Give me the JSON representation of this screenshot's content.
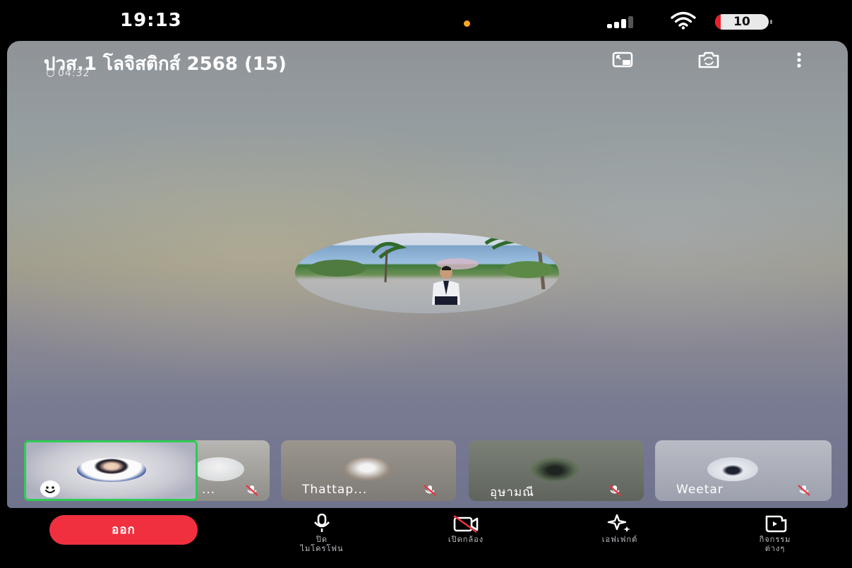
{
  "status_bar": {
    "time": "19:13",
    "battery_level": "10",
    "battery_fraction": 0.1,
    "signal_icon": "cellular-signal-icon",
    "wifi_icon": "wifi-icon",
    "dot_color": "#f5a623"
  },
  "call": {
    "room_title": "ปวส.1 โลจิสติกส์ 2568 (15)",
    "duration": "04:32",
    "top_icons": [
      "picture-in-picture-icon",
      "switch-camera-icon",
      "more-options-icon"
    ]
  },
  "participants": [
    {
      "name": "",
      "self": true,
      "emoji_icon": "smiley-icon"
    },
    {
      "name": "...",
      "mic_muted": true
    },
    {
      "name": "Thattap...",
      "mic_muted": true
    },
    {
      "name": "อุษามณี",
      "mic_muted": true
    },
    {
      "name": "Weetar",
      "mic_muted": true
    }
  ],
  "bottom_bar": {
    "leave_label": "ออก",
    "leave_color": "#f0303f",
    "actions": [
      {
        "label_line1": "ปิด",
        "label_line2": "ไมโครโฟน",
        "icon": "microphone-icon"
      },
      {
        "label_line1": "เปิดกล้อง",
        "label_line2": "",
        "icon": "camera-off-icon"
      },
      {
        "label_line1": "เอฟเฟกต์",
        "label_line2": "",
        "icon": "effects-sparkle-icon"
      },
      {
        "label_line1": "กิจกรรม",
        "label_line2": "ต่างๆ",
        "icon": "activities-icon"
      }
    ]
  },
  "accent_self_border": "#2ecc55"
}
